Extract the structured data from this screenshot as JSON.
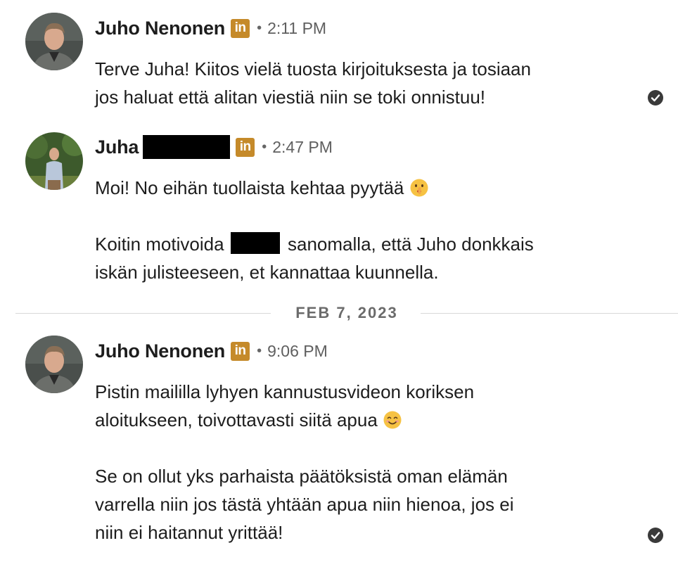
{
  "messages": [
    {
      "sender": "Juho Nenonen",
      "badge": "in",
      "separator": "•",
      "time": "2:11 PM",
      "lines": [
        "Terve Juha! Kiitos vielä tuosta kirjoituksesta ja tosiaan",
        "jos haluat että alitan viestiä niin se toki onnistuu!"
      ],
      "read_receipt": "check-icon"
    },
    {
      "sender": "Juha",
      "badge": "in",
      "separator": "•",
      "time": "2:47 PM",
      "line1_text": "Moi! No eihän tuollaista kehtaa pyytää",
      "line1_emoji": "shushing-face-emoji",
      "line2_before": "Koitin motivoida",
      "line2_after": "sanomalla, että Juho donkkais",
      "line3": "iskän julisteeseen, et kannattaa kuunnella."
    },
    {
      "sender": "Juho Nenonen",
      "badge": "in",
      "separator": "•",
      "time": "9:06 PM",
      "line1": "Pistin maililla lyhyen kannustusvideon koriksen",
      "line2_text": "aloitukseen, toivottavasti siitä apua",
      "line2_emoji": "smiling-face-emoji",
      "para2": [
        "Se on ollut yks parhaista päätöksistä oman elämän",
        "varrella niin jos tästä yhtään apua niin hienoa, jos ei",
        "niin ei haitannut yrittää!"
      ],
      "read_receipt": "check-icon"
    }
  ],
  "date_divider": "FEB 7, 2023",
  "colors": {
    "linkedin_badge": "#c58a2a",
    "text": "#1d1d1d",
    "muted": "#5f5f5f",
    "divider": "#d9d9d9",
    "redaction": "#000000"
  }
}
